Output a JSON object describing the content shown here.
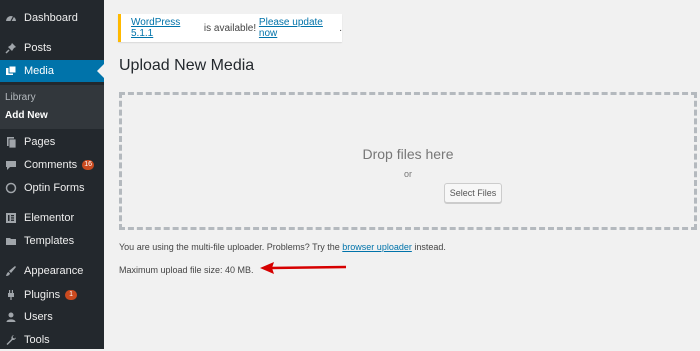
{
  "sidebar": {
    "items": [
      {
        "label": "Dashboard",
        "icon": "dashboard-icon"
      },
      {
        "label": "Posts",
        "icon": "pin-icon"
      },
      {
        "label": "Media",
        "icon": "media-icon",
        "active": true
      },
      {
        "label": "Pages",
        "icon": "pages-icon"
      },
      {
        "label": "Comments",
        "icon": "comment-icon",
        "badge": "16"
      },
      {
        "label": "Optin Forms",
        "icon": "optin-icon"
      },
      {
        "label": "Elementor",
        "icon": "elementor-icon"
      },
      {
        "label": "Templates",
        "icon": "folder-icon"
      },
      {
        "label": "Appearance",
        "icon": "brush-icon"
      },
      {
        "label": "Plugins",
        "icon": "plugin-icon",
        "badge": "1"
      },
      {
        "label": "Users",
        "icon": "user-icon"
      },
      {
        "label": "Tools",
        "icon": "wrench-icon"
      }
    ],
    "submenu": [
      {
        "label": "Library"
      },
      {
        "label": "Add New",
        "current": true
      }
    ]
  },
  "notice": {
    "link1": "WordPress 5.1.1",
    "mid": " is available! ",
    "link2": "Please update now",
    "end": "."
  },
  "page": {
    "title": "Upload New Media"
  },
  "dropzone": {
    "title": "Drop files here",
    "or": "or",
    "button": "Select Files"
  },
  "helper": {
    "prefix": "You are using the multi-file uploader. Problems? Try the ",
    "link": "browser uploader",
    "suffix": " instead."
  },
  "max_upload": "Maximum upload file size: 40 MB.",
  "colors": {
    "sidebar": "#23282d",
    "active": "#0073aa",
    "arrow": "#d60000",
    "notice_border": "#ffb900"
  }
}
